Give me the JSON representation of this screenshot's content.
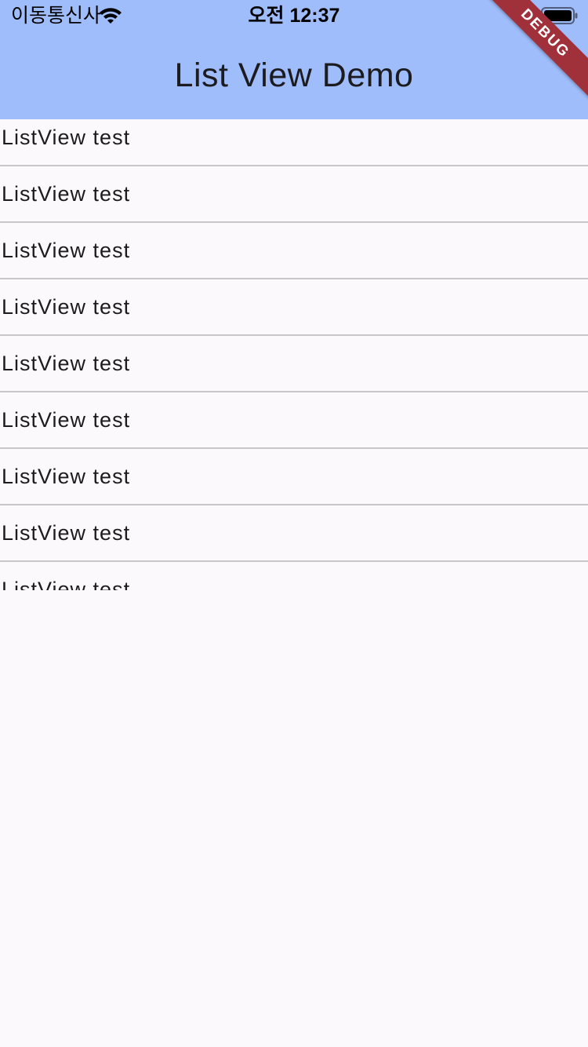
{
  "status_bar": {
    "carrier": "이동통신사",
    "time": "오전 12:37",
    "wifi_icon": "wifi-icon",
    "battery_icon": "battery-full-icon"
  },
  "app_bar": {
    "title": "List View Demo",
    "background_color": "#a0bdfb"
  },
  "debug_banner": {
    "label": "DEBUG",
    "color": "#a0303a"
  },
  "list": {
    "items": [
      {
        "label": "ListView test"
      },
      {
        "label": "ListView test"
      },
      {
        "label": "ListView test"
      },
      {
        "label": "ListView test"
      },
      {
        "label": "ListView test"
      },
      {
        "label": "ListView test"
      },
      {
        "label": "ListView test"
      },
      {
        "label": "ListView test"
      },
      {
        "label": "ListView test"
      }
    ],
    "divider_color": "#c8c6ca"
  },
  "page": {
    "background_color": "#fcf9fd"
  }
}
